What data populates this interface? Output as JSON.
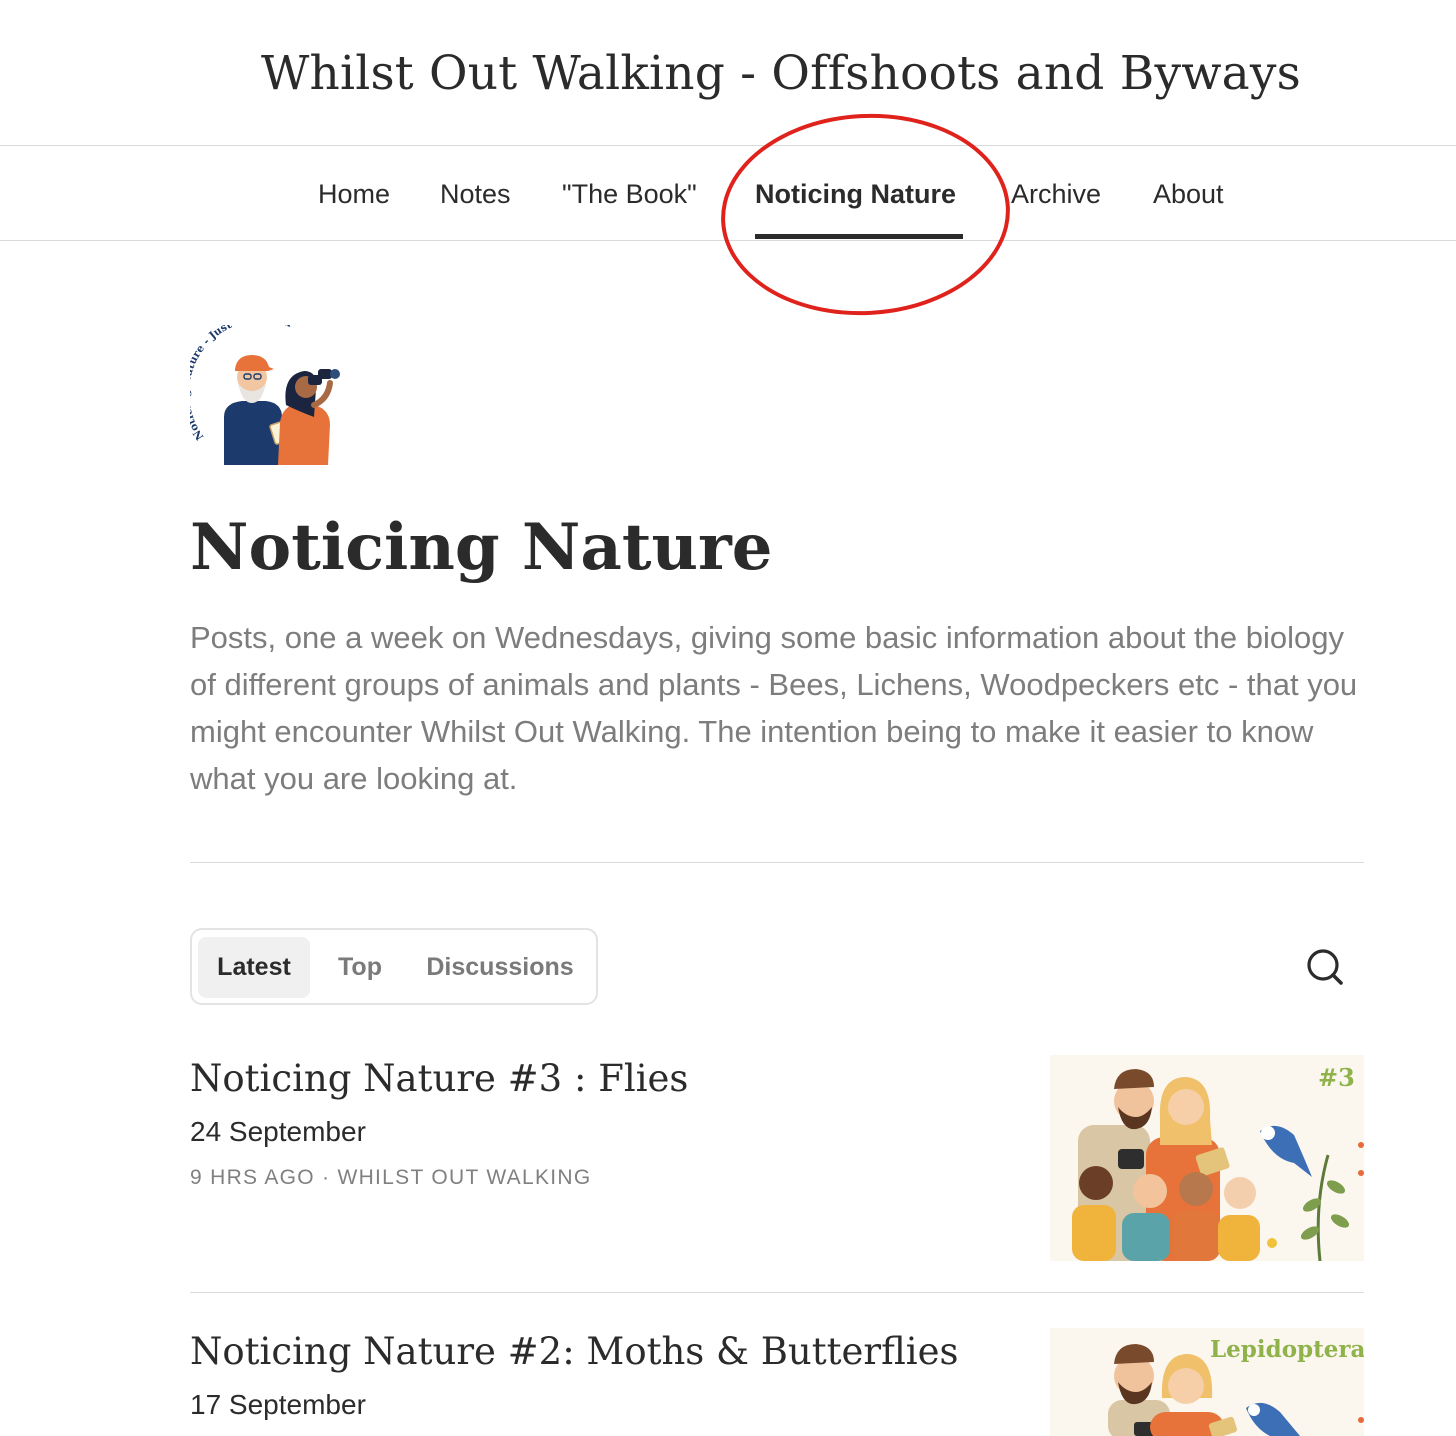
{
  "header": {
    "site_title": "Whilst Out Walking - Offshoots and Byways"
  },
  "nav": {
    "items": [
      {
        "label": "Home"
      },
      {
        "label": "Notes"
      },
      {
        "label": "\"The Book\""
      },
      {
        "label": "Noticing Nature",
        "active": true
      },
      {
        "label": "Archive"
      },
      {
        "label": "About"
      }
    ],
    "highlight_color": "#e0221c"
  },
  "section": {
    "logo_text": "Noticing Nature - Just One Hour",
    "title": "Noticing Nature",
    "description": "Posts, one a week on Wednesdays, giving some basic information about the biology of different groups of animals and plants - Bees, Lichens, Woodpeckers etc - that you might encounter Whilst Out Walking. The intention being to make it easier to know what you are looking at."
  },
  "tabs": {
    "items": [
      {
        "label": "Latest",
        "active": true
      },
      {
        "label": "Top"
      },
      {
        "label": "Discussions"
      }
    ],
    "search_icon": "search-icon"
  },
  "posts": [
    {
      "title": "Noticing Nature #3 : Flies",
      "subtitle": "24 September",
      "meta": "9 HRS AGO · WHILST OUT WALKING",
      "thumb_label": "#3 -"
    },
    {
      "title": "Noticing Nature #2: Moths & Butterflies",
      "subtitle": "17 September",
      "thumb_label": "Lepidoptera"
    }
  ],
  "colors": {
    "text": "#2b2b2b",
    "muted": "#7d7d7d",
    "divider": "#dadada",
    "logo_navy": "#1c3a6b",
    "logo_orange": "#e8733a"
  }
}
